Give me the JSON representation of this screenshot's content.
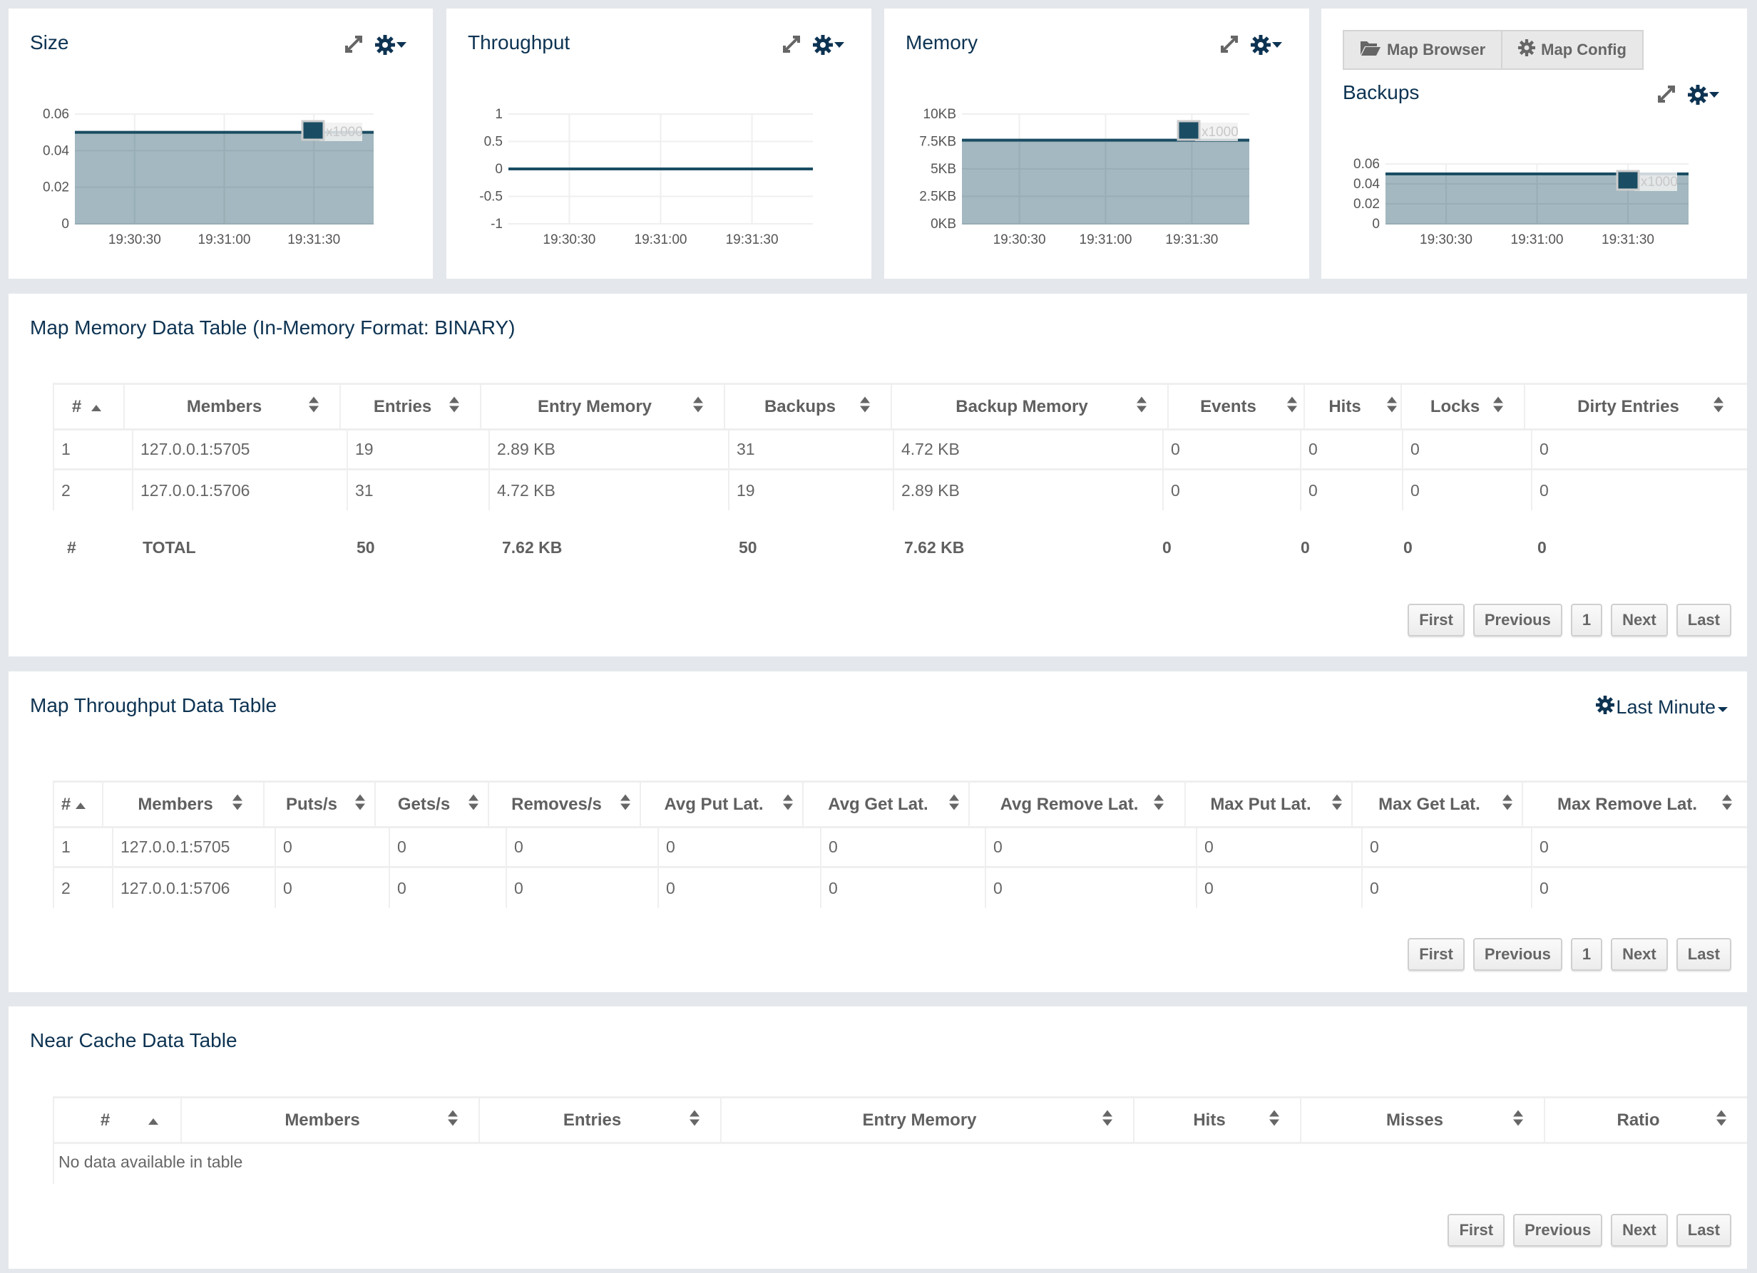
{
  "colors": {
    "background": "#e4e8ec",
    "title": "#0d3352",
    "series_line": "#1a4d63",
    "series_fill": "#a3b8c0",
    "header_text": "#606060",
    "cell_text": "#666666"
  },
  "charts": {
    "size": {
      "title": "Size",
      "legend": "x1000"
    },
    "throughput": {
      "title": "Throughput"
    },
    "memory": {
      "title": "Memory",
      "legend": "x1000"
    },
    "backups": {
      "title": "Backups",
      "legend": "x1000"
    }
  },
  "toolbar": {
    "map_browser": "Map Browser",
    "map_config": "Map Config"
  },
  "chart_data": [
    {
      "type": "area",
      "title": "Size",
      "x": [
        "19:30:30",
        "19:31:00",
        "19:31:30"
      ],
      "x_tick_labels": [
        "19:30:30",
        "19:31:00",
        "19:31:30"
      ],
      "y_tick_labels": [
        "0",
        "0.02",
        "0.04",
        "0.06"
      ],
      "ylim": [
        0,
        0.06
      ],
      "series": [
        {
          "name": "x1000",
          "values": [
            0.05,
            0.05,
            0.05,
            0.05
          ]
        }
      ],
      "legend": "top-right",
      "grid": true
    },
    {
      "type": "line",
      "title": "Throughput",
      "x_tick_labels": [
        "19:30:30",
        "19:31:00",
        "19:31:30"
      ],
      "y_tick_labels": [
        "-1",
        "-0.5",
        "0",
        "0.5",
        "1"
      ],
      "ylim": [
        -1,
        1
      ],
      "series": [
        {
          "name": "throughput",
          "values": [
            0,
            0,
            0,
            0
          ]
        }
      ],
      "grid": true
    },
    {
      "type": "area",
      "title": "Memory",
      "x_tick_labels": [
        "19:30:30",
        "19:31:00",
        "19:31:30"
      ],
      "y_tick_labels": [
        "0KB",
        "2.5KB",
        "5KB",
        "7.5KB",
        "10KB"
      ],
      "ylim": [
        0,
        10
      ],
      "y_unit": "KB",
      "series": [
        {
          "name": "x1000",
          "values": [
            7.62,
            7.62,
            7.62,
            7.62
          ]
        }
      ],
      "legend": "top-right",
      "grid": true
    },
    {
      "type": "area",
      "title": "Backups",
      "x_tick_labels": [
        "19:30:30",
        "19:31:00",
        "19:31:30"
      ],
      "y_tick_labels": [
        "0",
        "0.02",
        "0.04",
        "0.06"
      ],
      "ylim": [
        0,
        0.06
      ],
      "series": [
        {
          "name": "x1000",
          "values": [
            0.05,
            0.05,
            0.05,
            0.05
          ]
        }
      ],
      "legend": "top-right",
      "grid": true
    }
  ],
  "memory_table": {
    "title": "Map Memory Data Table (In-Memory Format: BINARY)",
    "columns": [
      "#",
      "Members",
      "Entries",
      "Entry Memory",
      "Backups",
      "Backup Memory",
      "Events",
      "Hits",
      "Locks",
      "Dirty Entries"
    ],
    "rows": [
      [
        "1",
        "127.0.0.1:5705",
        "19",
        "2.89 KB",
        "31",
        "4.72 KB",
        "0",
        "0",
        "0",
        "0"
      ],
      [
        "2",
        "127.0.0.1:5706",
        "31",
        "4.72 KB",
        "19",
        "2.89 KB",
        "0",
        "0",
        "0",
        "0"
      ]
    ],
    "total": [
      "#",
      "TOTAL",
      "50",
      "7.62 KB",
      "50",
      "7.62 KB",
      "0",
      "0",
      "0",
      "0"
    ],
    "pagination": [
      "First",
      "Previous",
      "1",
      "Next",
      "Last"
    ]
  },
  "throughput_table": {
    "title": "Map Throughput Data Table",
    "range_label": "Last Minute",
    "columns": [
      "#",
      "Members",
      "Puts/s",
      "Gets/s",
      "Removes/s",
      "Avg Put Lat.",
      "Avg Get Lat.",
      "Avg Remove Lat.",
      "Max Put Lat.",
      "Max Get Lat.",
      "Max Remove Lat."
    ],
    "rows": [
      [
        "1",
        "127.0.0.1:5705",
        "0",
        "0",
        "0",
        "0",
        "0",
        "0",
        "0",
        "0",
        "0"
      ],
      [
        "2",
        "127.0.0.1:5706",
        "0",
        "0",
        "0",
        "0",
        "0",
        "0",
        "0",
        "0",
        "0"
      ]
    ],
    "pagination": [
      "First",
      "Previous",
      "1",
      "Next",
      "Last"
    ]
  },
  "nearcache_table": {
    "title": "Near Cache Data Table",
    "columns": [
      "#",
      "Members",
      "Entries",
      "Entry Memory",
      "Hits",
      "Misses",
      "Ratio"
    ],
    "empty_message": "No data available in table",
    "pagination": [
      "First",
      "Previous",
      "Next",
      "Last"
    ]
  }
}
